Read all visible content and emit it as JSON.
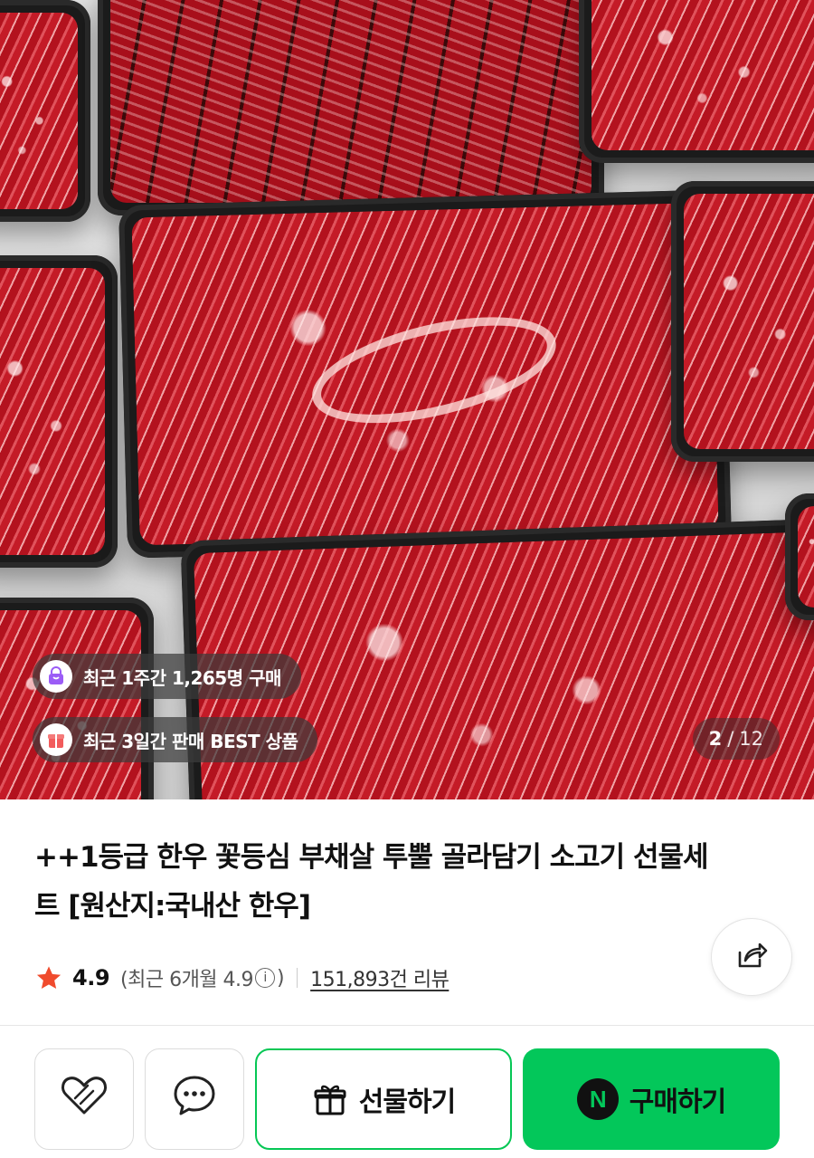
{
  "hero": {
    "badges": [
      {
        "icon": "shopping-bag-icon",
        "text": "최근 1주간 1,265명 구매"
      },
      {
        "icon": "gift-box-icon",
        "text": "최근 3일간 판매 BEST 상품"
      }
    ],
    "image_counter": {
      "current": "2",
      "separator": "/",
      "total": "12"
    }
  },
  "product": {
    "title": "++1등급 한우 꽃등심 부채살 투뿔 골라담기 소고기 선물세트 [원산지:국내산 한우]",
    "rating": {
      "score": "4.9",
      "recent_prefix": "(최근 6개월 4.9",
      "info_glyph": "i",
      "recent_suffix": ")",
      "reviews": "151,893건 리뷰"
    }
  },
  "actions": {
    "gift_label": "선물하기",
    "buy_label": "구매하기",
    "buy_badge": "N"
  },
  "colors": {
    "accent_green": "#03c75a",
    "star": "#f04b2d",
    "badge_purple": "#9b5cf6",
    "badge_red": "#f25c5c"
  }
}
